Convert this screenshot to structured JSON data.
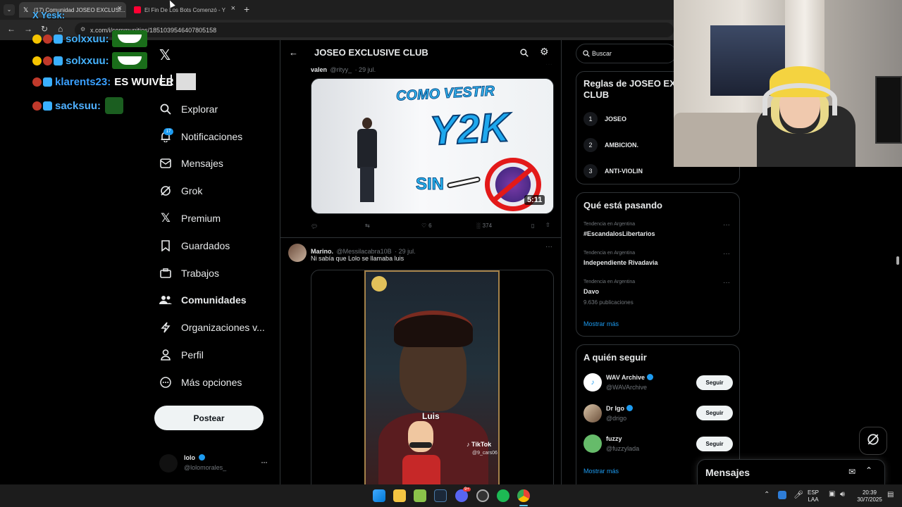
{
  "browser": {
    "tabs": [
      {
        "label": "(17) Comunidad JOSEO EXCLUSI...",
        "active": true
      },
      {
        "label": "El Fin De Los Bots Comenzó - Y",
        "active": false
      }
    ],
    "address": "x.com/i/communities/1851039546407805158"
  },
  "overlay_chat": [
    {
      "user": "solxxuu:",
      "text": "",
      "color": "#46b3ff"
    },
    {
      "user": "solxxuu:",
      "text": "",
      "color": "#46b3ff"
    },
    {
      "user": "klarents23:",
      "text": "ES WUIVER",
      "color": "#3aa0ff"
    },
    {
      "user": "sacksuu:",
      "text": "",
      "color": "#4fb0ff"
    }
  ],
  "overlay_top_text": "X Yesk:",
  "sidebar": {
    "items": [
      {
        "label": "Explorar",
        "icon": "search-icon"
      },
      {
        "label": "Notificaciones",
        "icon": "bell-icon"
      },
      {
        "label": "Mensajes",
        "icon": "mail-icon"
      },
      {
        "label": "Grok",
        "icon": "grok-icon"
      },
      {
        "label": "Premium",
        "icon": "x-logo-icon"
      },
      {
        "label": "Guardados",
        "icon": "bookmark-icon"
      },
      {
        "label": "Trabajos",
        "icon": "briefcase-icon"
      },
      {
        "label": "Comunidades",
        "icon": "people-icon"
      },
      {
        "label": "Organizaciones v...",
        "icon": "lightning-icon"
      },
      {
        "label": "Perfil",
        "icon": "person-icon"
      },
      {
        "label": "Más opciones",
        "icon": "more-circle-icon"
      }
    ],
    "notif_count": "17",
    "post_label": "Postear",
    "account": {
      "name": "lolo",
      "handle": "@lolomorales_"
    }
  },
  "main": {
    "title": "JOSEO EXCLUSIVE CLUB",
    "post1": {
      "author": "valen",
      "handle": "@rityy_",
      "date": "· 29 jul.",
      "thumb_title_1": "COMO VESTIR",
      "thumb_title_2": "Y2K",
      "thumb_sin": "SIN",
      "duration": "5:11",
      "likes": "6",
      "views": "374"
    },
    "post2": {
      "author": "Marino.",
      "handle": "@Messilacabra10B",
      "date": "· 29 jul.",
      "text": "Ni sabía que Lolo se llamaba luis",
      "image_label": "Luis",
      "tiktok": "TikTok",
      "tiktok_handle": "@9_cars06"
    }
  },
  "right": {
    "search_placeholder": "Buscar",
    "rules": {
      "title_1": "Reglas de JOSEO EX",
      "title_2": "CLUB",
      "items": [
        {
          "num": "1",
          "label": "JOSEO"
        },
        {
          "num": "2",
          "label": "AMBICION."
        },
        {
          "num": "3",
          "label": "ANTI-VIOLIN"
        }
      ]
    },
    "trends": {
      "title": "Qué está pasando",
      "items": [
        {
          "category": "Tendencia en Argentina",
          "name": "#EscandalosLibertarios",
          "count": ""
        },
        {
          "category": "Tendencia en Argentina",
          "name": "Independiente Rivadavia",
          "count": ""
        },
        {
          "category": "Tendencia en Argentina",
          "name": "Davo",
          "count": "9.636 publicaciones"
        }
      ],
      "more": "Mostrar más"
    },
    "follow": {
      "title": "A quién seguir",
      "items": [
        {
          "name": "WAV Archive",
          "handle": "@WAVArchive",
          "button": "Seguir"
        },
        {
          "name": "Dr Igo",
          "handle": "@drigo",
          "button": "Seguir"
        },
        {
          "name": "fuzzy",
          "handle": "@fuzzylada",
          "button": "Seguir"
        }
      ],
      "more": "Mostrar más"
    }
  },
  "messages_drawer": {
    "title": "Mensajes"
  },
  "taskbar": {
    "lang_1": "ESP",
    "lang_2": "LAA",
    "time": "20:39",
    "date": "30/7/2025",
    "discord_badge": "9+"
  },
  "colors": {
    "accent": "#1d9bf0",
    "border": "#2f3336",
    "muted": "#71767b"
  }
}
